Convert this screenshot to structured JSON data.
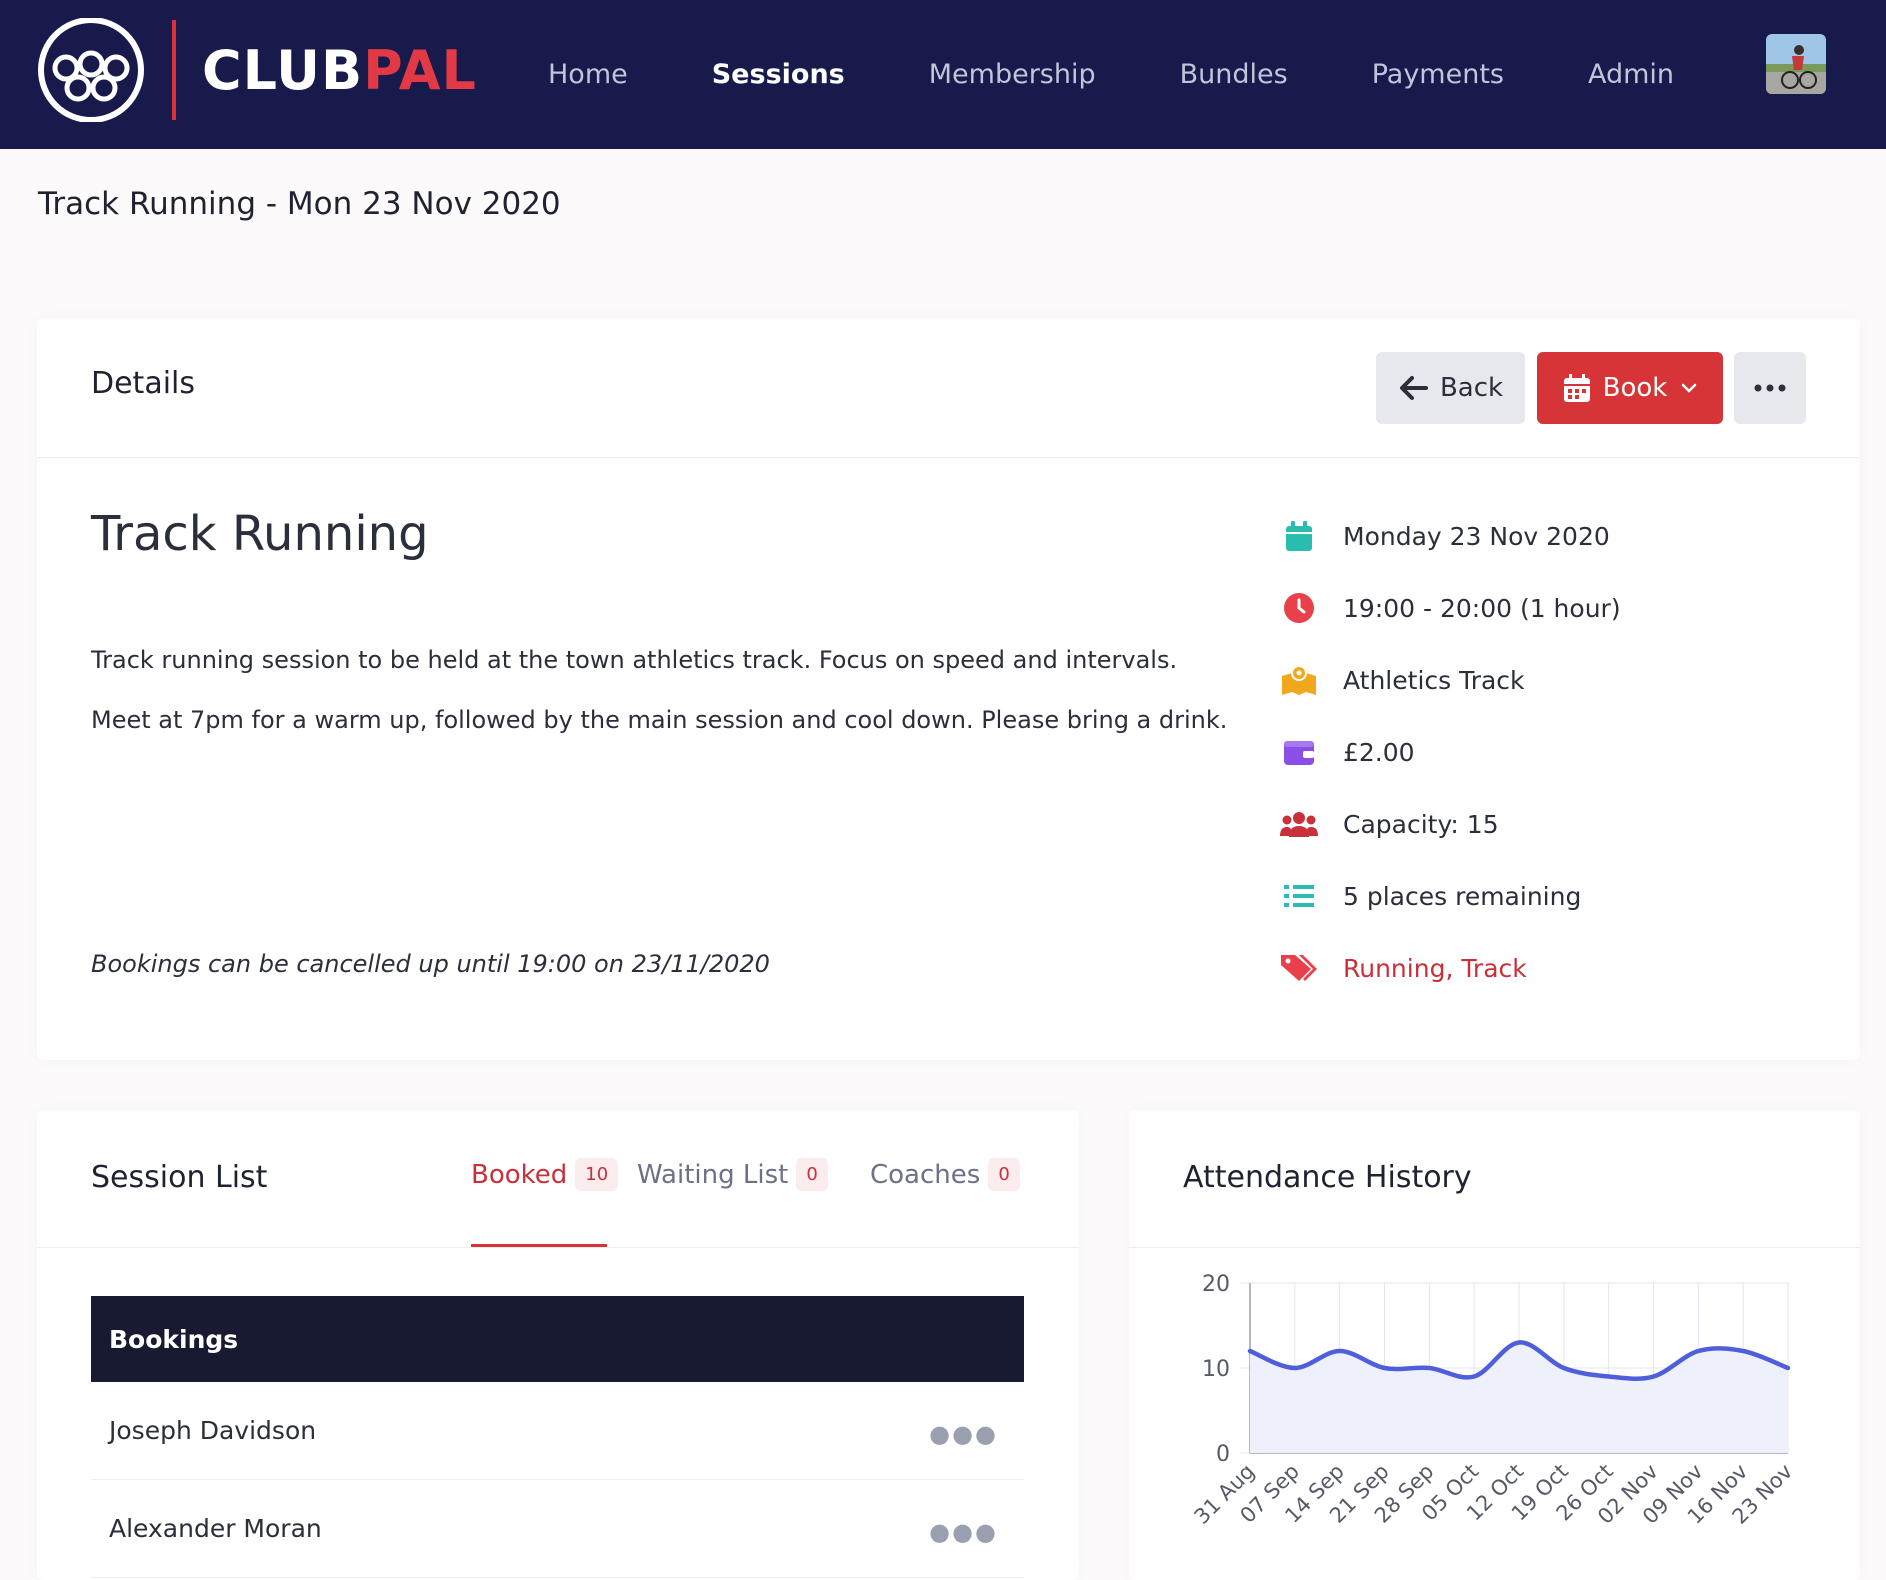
{
  "brand": {
    "name_primary": "CLUB",
    "name_accent": "PAL",
    "primary_color": "#181a4b",
    "accent_color": "#e23a45"
  },
  "nav": {
    "items": [
      {
        "label": "Home",
        "active": false
      },
      {
        "label": "Sessions",
        "active": true
      },
      {
        "label": "Membership",
        "active": false
      },
      {
        "label": "Bundles",
        "active": false
      },
      {
        "label": "Payments",
        "active": false
      },
      {
        "label": "Admin",
        "active": false
      }
    ]
  },
  "page": {
    "title": "Track Running - Mon 23 Nov 2020"
  },
  "details": {
    "title": "Details",
    "buttons": {
      "back": "Back",
      "book": "Book"
    },
    "session_name": "Track Running",
    "description": [
      "Track running session to be held at the town athletics track. Focus on speed and intervals.",
      "Meet at 7pm for a warm up, followed by the main session and cool down. Please bring a drink."
    ],
    "cancel_note": "Bookings can be cancelled up until 19:00 on 23/11/2020",
    "info": {
      "date": "Monday 23 Nov 2020",
      "time": "19:00 - 20:00 (1 hour)",
      "location": "Athletics Track",
      "price": "£2.00",
      "capacity": "Capacity: 15",
      "remaining": "5 places remaining",
      "tags": "Running, Track"
    },
    "icons": [
      "calendar-icon",
      "clock-icon",
      "map-icon",
      "wallet-icon",
      "users-icon",
      "list-icon",
      "tags-icon"
    ]
  },
  "session_list": {
    "title": "Session List",
    "tabs": [
      {
        "label": "Booked",
        "count": "10"
      },
      {
        "label": "Waiting List",
        "count": "0"
      },
      {
        "label": "Coaches",
        "count": "0"
      }
    ],
    "bookings_header": "Bookings",
    "rows": [
      "Joseph Davidson",
      "Alexander Moran"
    ]
  },
  "attendance": {
    "title": "Attendance History",
    "chart_data": {
      "type": "area",
      "x": [
        "31 Aug",
        "07 Sep",
        "14 Sep",
        "21 Sep",
        "28 Sep",
        "05 Oct",
        "12 Oct",
        "19 Oct",
        "26 Oct",
        "02 Nov",
        "09 Nov",
        "16 Nov",
        "23 Nov"
      ],
      "values": [
        12,
        10,
        12,
        10,
        10,
        9,
        13,
        10,
        9,
        9,
        12,
        12,
        10
      ],
      "ylim": [
        0,
        20
      ],
      "yticks": [
        0,
        10,
        20
      ],
      "grid": true,
      "line_color": "#4f5fdc",
      "fill_color": "#eef0fb"
    }
  }
}
